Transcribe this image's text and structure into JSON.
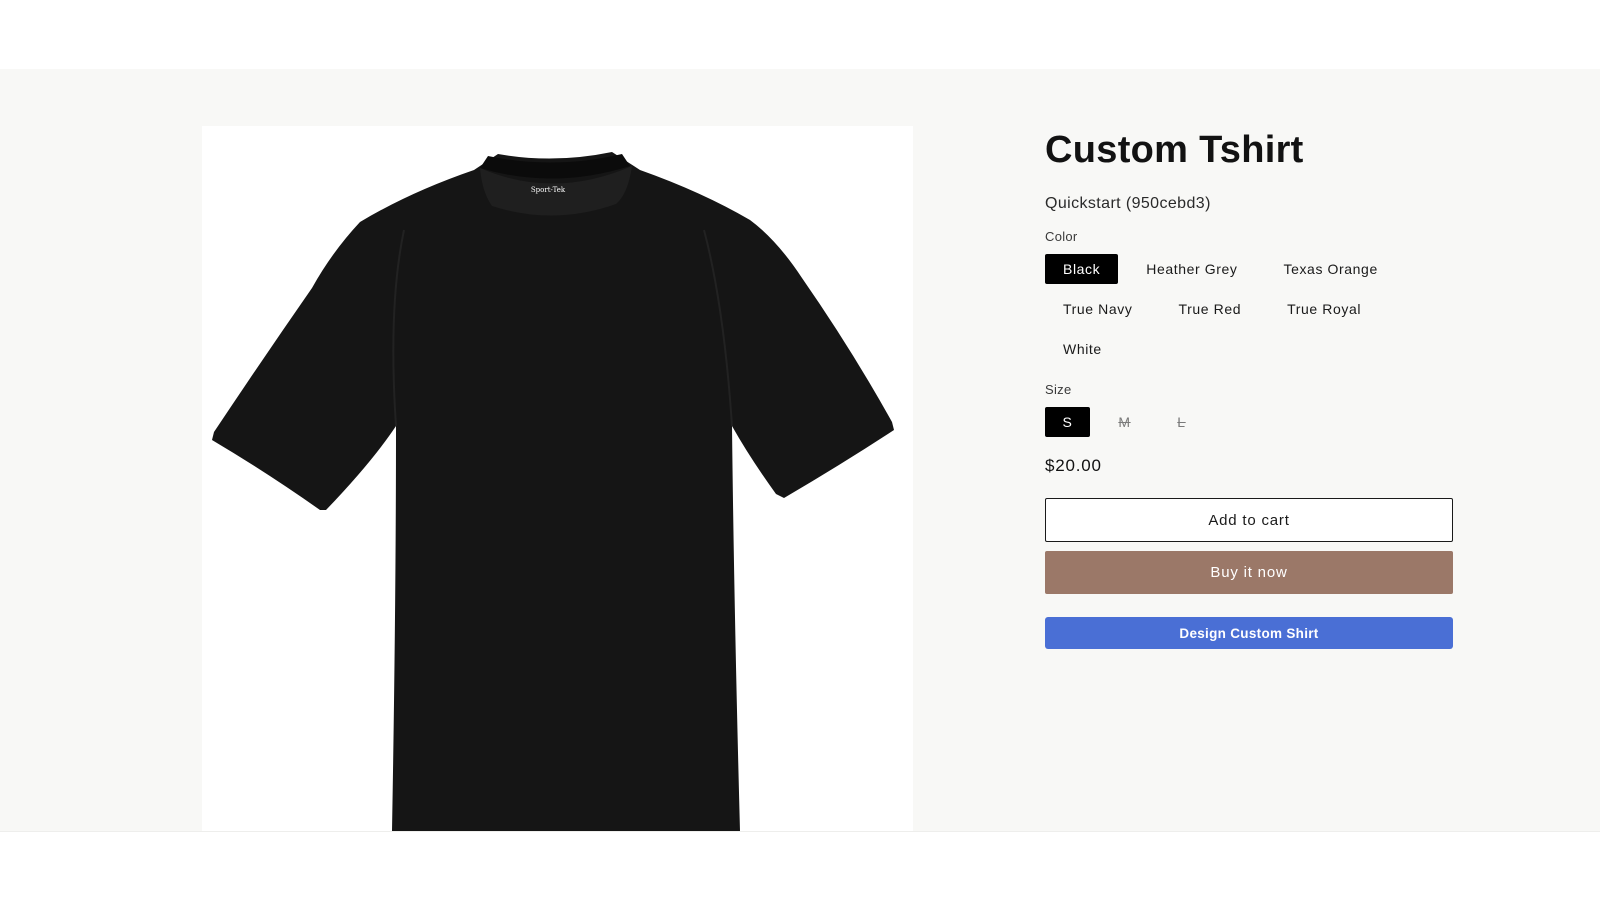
{
  "product": {
    "title": "Custom Tshirt",
    "vendor": "Quickstart (950cebd3)",
    "image_label": "Sport-Tek",
    "image_icon": "tshirt-black",
    "color": {
      "label": "Color",
      "options": [
        "Black",
        "Heather Grey",
        "Texas Orange",
        "True Navy",
        "True Red",
        "True Royal",
        "White"
      ],
      "selected": "Black"
    },
    "size": {
      "label": "Size",
      "options": [
        "S",
        "M",
        "L"
      ],
      "selected": "S",
      "unavailable": [
        "M",
        "L"
      ]
    },
    "price": "$20.00",
    "add_to_cart_label": "Add to cart",
    "buy_now_label": "Buy it now",
    "design_label": "Design Custom Shirt"
  },
  "colors": {
    "section_bg": "#f8f8f6",
    "buy_now": "#9b7868",
    "design_button": "#4a6fd5",
    "selected_pill": "#000000"
  }
}
